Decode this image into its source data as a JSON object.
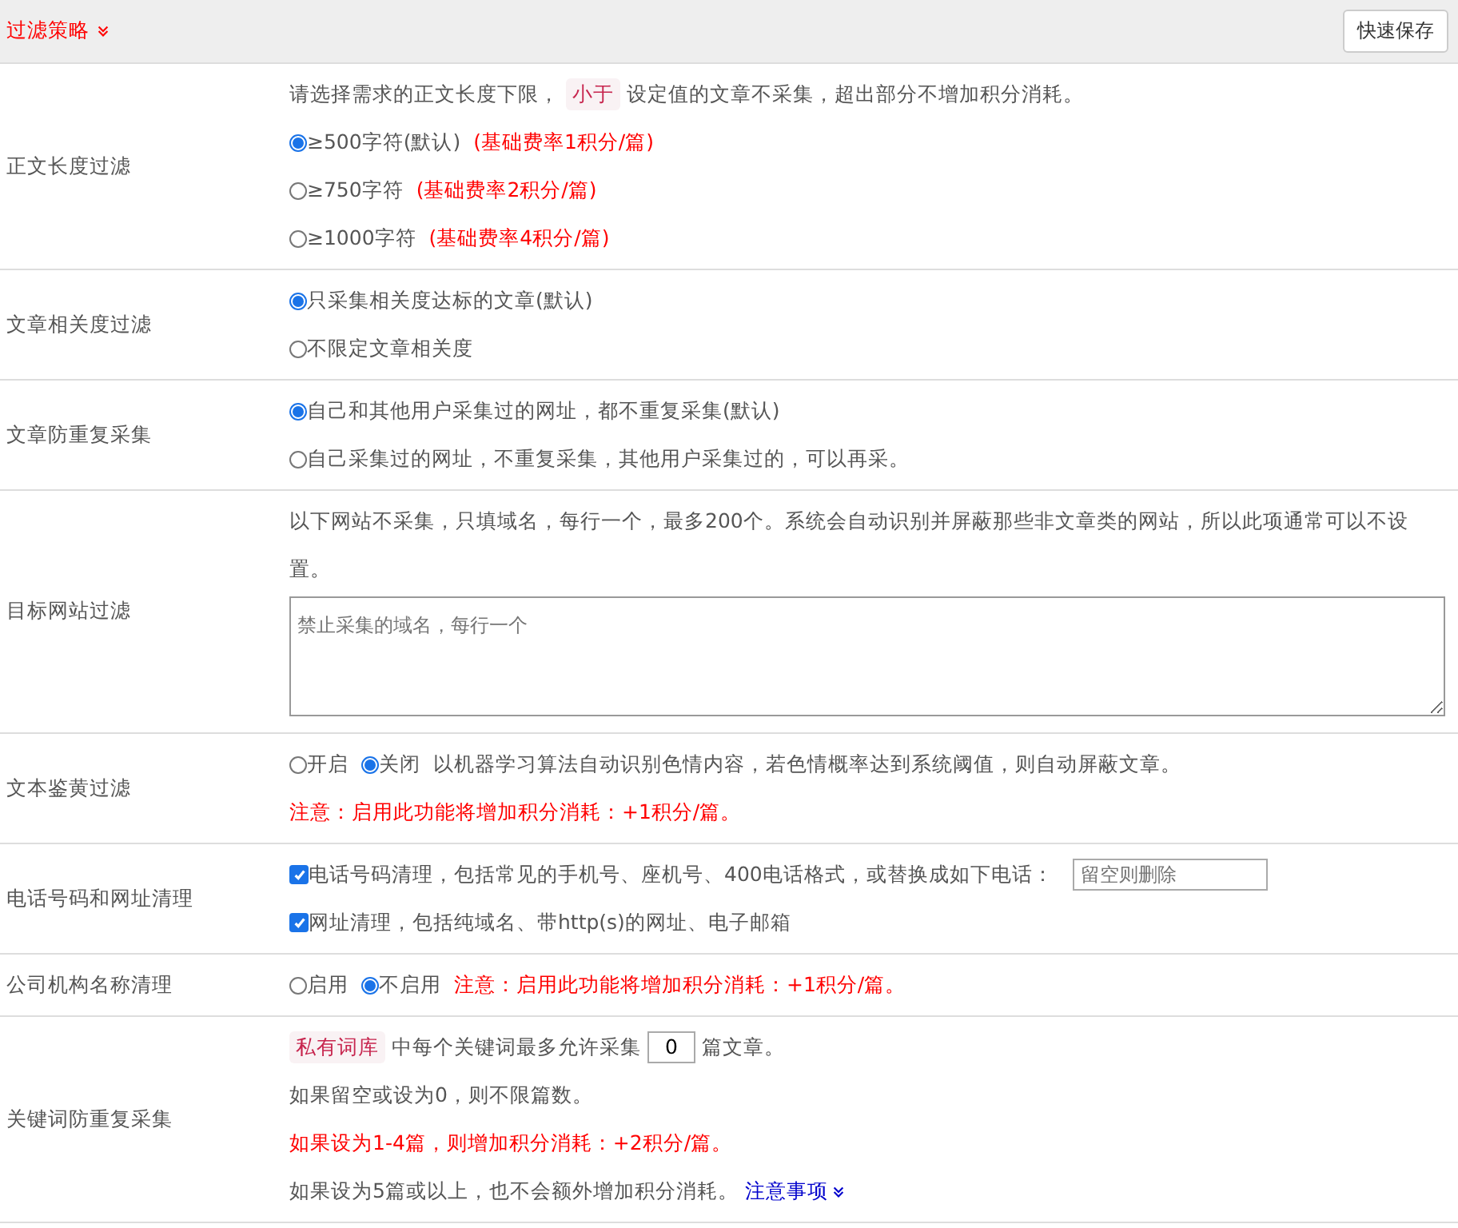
{
  "header": {
    "title": "过滤策略",
    "save_button": "快速保存"
  },
  "rows": [
    {
      "label": "正文长度过滤",
      "lines": [
        [
          {
            "kind": "plain",
            "text": "请选择需求的正文长度下限，"
          },
          {
            "kind": "tag",
            "text": "小于"
          },
          {
            "kind": "plain",
            "text": "设定值的文章不采集，超出部分不增加积分消耗。"
          }
        ],
        [
          {
            "kind": "radio",
            "text": "≥500字符(默认)",
            "selected": true
          },
          {
            "kind": "red",
            "text": "(基础费率1积分/篇)"
          }
        ],
        [
          {
            "kind": "radio",
            "text": "≥750字符",
            "selected": false
          },
          {
            "kind": "red",
            "text": "(基础费率2积分/篇)"
          }
        ],
        [
          {
            "kind": "radio",
            "text": "≥1000字符",
            "selected": false
          },
          {
            "kind": "red",
            "text": "(基础费率4积分/篇)"
          }
        ]
      ]
    },
    {
      "label": "文章相关度过滤",
      "lines": [
        [
          {
            "kind": "radio",
            "text": "只采集相关度达标的文章(默认)",
            "selected": true
          }
        ],
        [
          {
            "kind": "radio",
            "text": "不限定文章相关度",
            "selected": false
          }
        ]
      ]
    },
    {
      "label": "文章防重复采集",
      "lines": [
        [
          {
            "kind": "radio",
            "text": "自己和其他用户采集过的网址，都不重复采集(默认)",
            "selected": true
          }
        ],
        [
          {
            "kind": "radio",
            "text": "自己采集过的网址，不重复采集，其他用户采集过的，可以再采。",
            "selected": false
          }
        ]
      ]
    },
    {
      "label": "目标网站过滤",
      "lines": [
        [
          {
            "kind": "plain",
            "text": "以下网站不采集，只填域名，每行一个，最多200个。系统会自动识别并屏蔽那些非文章类的网站，所以此项通常可以不设置。"
          }
        ],
        [
          {
            "kind": "textarea",
            "placeholder": "禁止采集的域名，每行一个"
          }
        ]
      ]
    },
    {
      "label": "文本鉴黄过滤",
      "lines": [
        [
          {
            "kind": "radio",
            "text": "开启",
            "selected": false
          },
          {
            "kind": "radio",
            "text": "关闭",
            "selected": true
          },
          {
            "kind": "plain",
            "text": "以机器学习算法自动识别色情内容，若色情概率达到系统阈值，则自动屏蔽文章。"
          }
        ],
        [
          {
            "kind": "red",
            "text": "注意：启用此功能将增加积分消耗：+1积分/篇。"
          }
        ]
      ]
    },
    {
      "label": "电话号码和网址清理",
      "lines": [
        [
          {
            "kind": "checkbox",
            "text": "电话号码清理，包括常见的手机号、座机号、400电话格式，或替换成如下电话：",
            "checked": true
          },
          {
            "kind": "input",
            "placeholder": "留空则删除"
          }
        ],
        [
          {
            "kind": "checkbox",
            "text": "网址清理，包括纯域名、带http(s)的网址、电子邮箱",
            "checked": true
          }
        ]
      ]
    },
    {
      "label": "公司机构名称清理",
      "lines": [
        [
          {
            "kind": "radio",
            "text": "启用",
            "selected": false
          },
          {
            "kind": "radio",
            "text": "不启用",
            "selected": true
          },
          {
            "kind": "red",
            "text": "注意：启用此功能将增加积分消耗：+1积分/篇。"
          }
        ]
      ]
    },
    {
      "label": "关键词防重复采集",
      "lines": [
        [
          {
            "kind": "tag",
            "text": "私有词库"
          },
          {
            "kind": "plain",
            "text": "中每个关键词最多允许采集"
          },
          {
            "kind": "number",
            "value": "0"
          },
          {
            "kind": "plain",
            "text": "篇文章。"
          }
        ],
        [
          {
            "kind": "plain",
            "text": "如果留空或设为0，则不限篇数。"
          }
        ],
        [
          {
            "kind": "red",
            "text": "如果设为1-4篇，则增加积分消耗：+2积分/篇。"
          }
        ],
        [
          {
            "kind": "plain",
            "text": "如果设为5篇或以上，也不会额外增加积分消耗。"
          },
          {
            "kind": "link",
            "text": "注意事项"
          }
        ]
      ]
    }
  ]
}
